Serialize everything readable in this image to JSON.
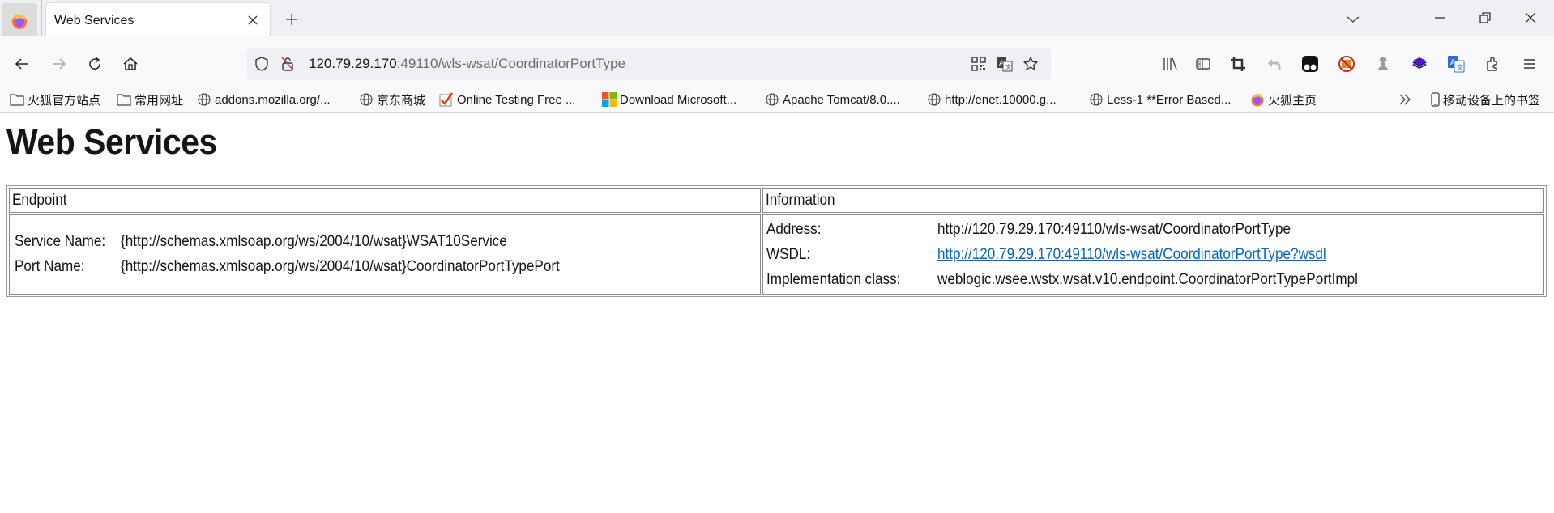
{
  "browser": {
    "tab": {
      "title": "Web Services"
    },
    "new_tab_label": "+",
    "url": {
      "host": "120.79.29.170",
      "rest": ":49110/wls-wsat/CoordinatorPortType"
    },
    "bookmarks": [
      {
        "label": "火狐官方站点",
        "icon": "folder-icon"
      },
      {
        "label": "常用网址",
        "icon": "folder-icon"
      },
      {
        "label": "addons.mozilla.org/...",
        "icon": "globe-icon"
      },
      {
        "label": "京东商城",
        "icon": "globe-icon"
      },
      {
        "label": "Online Testing Free ...",
        "icon": "checkbox-icon"
      },
      {
        "label": "Download Microsoft...",
        "icon": "microsoft-logo-icon"
      },
      {
        "label": "Apache Tomcat/8.0....",
        "icon": "globe-icon"
      },
      {
        "label": "http://enet.10000.g...",
        "icon": "globe-icon"
      },
      {
        "label": "Less-1 **Error Based...",
        "icon": "globe-icon"
      },
      {
        "label": "火狐主页",
        "icon": "firefox-icon"
      }
    ],
    "overflow_label": "»",
    "mobile_bookmarks": "移动设备上的书签"
  },
  "page": {
    "title": "Web Services",
    "table": {
      "headers": [
        "Endpoint",
        "Information"
      ],
      "endpoint": {
        "service_name_label": "Service Name:",
        "service_name_value": "{http://schemas.xmlsoap.org/ws/2004/10/wsat}WSAT10Service",
        "port_name_label": "Port Name:",
        "port_name_value": "{http://schemas.xmlsoap.org/ws/2004/10/wsat}CoordinatorPortTypePort"
      },
      "information": {
        "address_label": "Address:",
        "address_value": "http://120.79.29.170:49110/wls-wsat/CoordinatorPortType",
        "wsdl_label": "WSDL:",
        "wsdl_value": "http://120.79.29.170:49110/wls-wsat/CoordinatorPortType?wsdl",
        "impl_label": "Implementation class:",
        "impl_value": "weblogic.wsee.wstx.wsat.v10.endpoint.CoordinatorPortTypePortImpl"
      }
    }
  },
  "colors": {
    "link": "#0066cc",
    "chrome_bg": "#f0f0f4",
    "toolbar_bg": "#f9f9fb"
  }
}
